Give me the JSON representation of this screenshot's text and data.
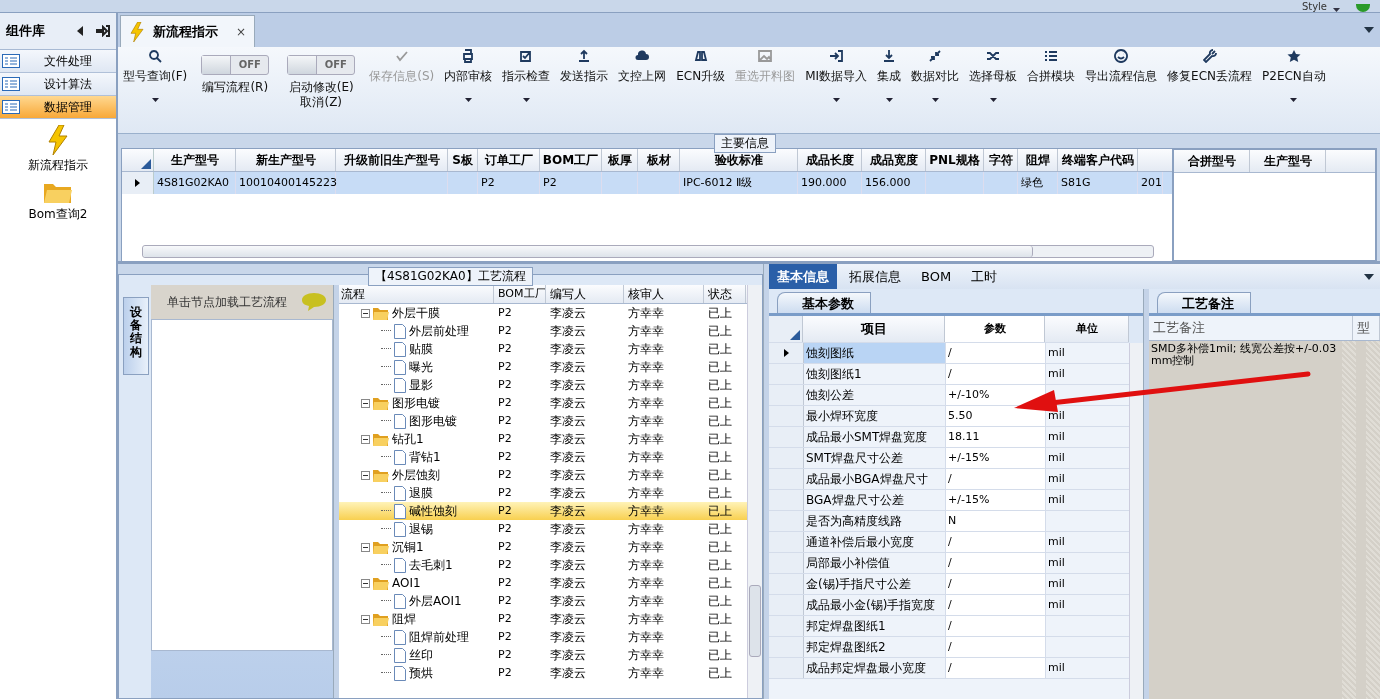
{
  "top_bar": {
    "style_menu": "Style"
  },
  "sidebar": {
    "title": "组件库",
    "items": [
      {
        "label": "文件处理",
        "selected": false
      },
      {
        "label": "设计算法",
        "selected": false
      },
      {
        "label": "数据管理",
        "selected": true
      }
    ],
    "shortcuts": [
      {
        "label": "新流程指示"
      },
      {
        "label": "Bom查询2"
      }
    ]
  },
  "tabs": [
    {
      "label": "新流程指示",
      "selected": true,
      "close": "×"
    }
  ],
  "toolbar": [
    {
      "kind": "button",
      "label": "型号查询(F)",
      "disabled": false,
      "dropdown": true
    },
    {
      "kind": "toggle",
      "label": "编写流程(R)",
      "toggle_text": "OFF",
      "on": false
    },
    {
      "kind": "toggle",
      "label": "启动修改(E) 取消(Z)",
      "toggle_text": "OFF",
      "on": false
    },
    {
      "kind": "button",
      "label": "保存信息(S)",
      "disabled": true,
      "dropdown": false
    },
    {
      "kind": "button",
      "label": "内部审核",
      "disabled": false,
      "dropdown": true
    },
    {
      "kind": "button",
      "label": "指示检查",
      "disabled": false,
      "dropdown": true
    },
    {
      "kind": "button",
      "label": "发送指示",
      "disabled": false,
      "dropdown": false
    },
    {
      "kind": "button",
      "label": "文控上网",
      "disabled": false,
      "dropdown": false
    },
    {
      "kind": "button",
      "label": "ECN升级",
      "disabled": false,
      "dropdown": false
    },
    {
      "kind": "button",
      "label": "重选开料图",
      "disabled": true,
      "dropdown": false
    },
    {
      "kind": "button",
      "label": "MI数据导入",
      "disabled": false,
      "dropdown": true
    },
    {
      "kind": "button",
      "label": "集成",
      "disabled": false,
      "dropdown": true
    },
    {
      "kind": "button",
      "label": "数据对比",
      "disabled": false,
      "dropdown": true
    },
    {
      "kind": "button",
      "label": "选择母板",
      "disabled": false,
      "dropdown": true
    },
    {
      "kind": "button",
      "label": "合拼模块",
      "disabled": false,
      "dropdown": false
    },
    {
      "kind": "button",
      "label": "导出流程信息",
      "disabled": false,
      "dropdown": false
    },
    {
      "kind": "button",
      "label": "修复ECN丢流程",
      "disabled": false,
      "dropdown": false
    },
    {
      "kind": "button",
      "label": "P2ECN自动",
      "disabled": false,
      "dropdown": true
    }
  ],
  "main_info": {
    "title": "主要信息",
    "columns": [
      "生产型号",
      "新生产型号",
      "升级前旧生产型号",
      "S板",
      "订单工厂",
      "BOM工厂",
      "板厚",
      "板材",
      "验收标准",
      "成品长度",
      "成品宽度",
      "PNL规格",
      "字符",
      "阻焊",
      "终端客户代码"
    ],
    "rows": [
      {
        "selected": true,
        "cells": [
          "4S81G02KA0",
          "10010400145223",
          null,
          null,
          "P2",
          "P2",
          null,
          null,
          "IPC-6012 Ⅱ级",
          "190.000",
          "156.000",
          null,
          null,
          "绿色",
          "S81G"
        ],
        "cut_cell": "201"
      }
    ],
    "side_columns": [
      "合拼型号",
      "生产型号"
    ]
  },
  "flow": {
    "title": "【4S81G02KA0】工艺流程",
    "side_tab": "设备结构",
    "hint": "单击节点加载工艺流程",
    "columns": [
      "流程",
      "BOM工厂",
      "编写人",
      "核审人",
      "状态"
    ],
    "rows": [
      {
        "name": "外层干膜",
        "bom": "P2",
        "writer": "李凌云",
        "reviewer": "方幸幸",
        "status": "已上",
        "expanded": true,
        "selected": false,
        "children": [
          {
            "name": "外层前处理",
            "bom": "P2",
            "writer": "李凌云",
            "reviewer": "方幸幸",
            "status": "已上",
            "selected": false
          },
          {
            "name": "贴膜",
            "bom": "P2",
            "writer": "李凌云",
            "reviewer": "方幸幸",
            "status": "已上",
            "selected": false
          },
          {
            "name": "曝光",
            "bom": "P2",
            "writer": "李凌云",
            "reviewer": "方幸幸",
            "status": "已上",
            "selected": false
          },
          {
            "name": "显影",
            "bom": "P2",
            "writer": "李凌云",
            "reviewer": "方幸幸",
            "status": "已上",
            "selected": false
          }
        ]
      },
      {
        "name": "图形电镀",
        "bom": "P2",
        "writer": "李凌云",
        "reviewer": "方幸幸",
        "status": "已上",
        "expanded": true,
        "selected": false,
        "children": [
          {
            "name": "图形电镀",
            "bom": "P2",
            "writer": "李凌云",
            "reviewer": "方幸幸",
            "status": "已上",
            "selected": false
          }
        ]
      },
      {
        "name": "钻孔1",
        "bom": "P2",
        "writer": "李凌云",
        "reviewer": "方幸幸",
        "status": "已上",
        "expanded": true,
        "selected": false,
        "children": [
          {
            "name": "背钻1",
            "bom": "P2",
            "writer": "李凌云",
            "reviewer": "方幸幸",
            "status": "已上",
            "selected": false
          }
        ]
      },
      {
        "name": "外层蚀刻",
        "bom": "P2",
        "writer": "李凌云",
        "reviewer": "方幸幸",
        "status": "已上",
        "expanded": true,
        "selected": false,
        "children": [
          {
            "name": "退膜",
            "bom": "P2",
            "writer": "李凌云",
            "reviewer": "方幸幸",
            "status": "已上",
            "selected": false
          },
          {
            "name": "碱性蚀刻",
            "bom": "P2",
            "writer": "李凌云",
            "reviewer": "方幸幸",
            "status": "已上",
            "selected": true
          },
          {
            "name": "退锡",
            "bom": "P2",
            "writer": "李凌云",
            "reviewer": "方幸幸",
            "status": "已上",
            "selected": false
          }
        ]
      },
      {
        "name": "沉铜1",
        "bom": "P2",
        "writer": "李凌云",
        "reviewer": "方幸幸",
        "status": "已上",
        "expanded": true,
        "selected": false,
        "children": [
          {
            "name": "去毛刺1",
            "bom": "P2",
            "writer": "李凌云",
            "reviewer": "方幸幸",
            "status": "已上",
            "selected": false
          }
        ]
      },
      {
        "name": "AOI1",
        "bom": "P2",
        "writer": "李凌云",
        "reviewer": "方幸幸",
        "status": "已上",
        "expanded": true,
        "selected": false,
        "children": [
          {
            "name": "外层AOI1",
            "bom": "P2",
            "writer": "李凌云",
            "reviewer": "方幸幸",
            "status": "已上",
            "selected": false
          }
        ]
      },
      {
        "name": "阻焊",
        "bom": "P2",
        "writer": "李凌云",
        "reviewer": "方幸幸",
        "status": "已上",
        "expanded": true,
        "selected": false,
        "children": [
          {
            "name": "阻焊前处理",
            "bom": "P2",
            "writer": "李凌云",
            "reviewer": "方幸幸",
            "status": "已上",
            "selected": false
          },
          {
            "name": "丝印",
            "bom": "P2",
            "writer": "李凌云",
            "reviewer": "方幸幸",
            "status": "已上",
            "selected": false
          },
          {
            "name": "预烘",
            "bom": "P2",
            "writer": "李凌云",
            "reviewer": "方幸幸",
            "status": "已上",
            "selected": false
          }
        ]
      }
    ]
  },
  "detail_tabs": [
    {
      "label": "基本信息",
      "selected": true
    },
    {
      "label": "拓展信息",
      "selected": false
    },
    {
      "label": "BOM",
      "selected": false
    },
    {
      "label": "工时",
      "selected": false
    }
  ],
  "params": {
    "title": "基本参数",
    "columns": [
      "项目",
      "参数",
      "单位"
    ],
    "rows": [
      {
        "item": "蚀刻图纸",
        "value": "/",
        "unit": "mil",
        "selected": true
      },
      {
        "item": "蚀刻图纸1",
        "value": "/",
        "unit": "mil",
        "selected": false
      },
      {
        "item": "蚀刻公差",
        "value": "+/-10%",
        "selected": false
      },
      {
        "item": "最小焊环宽度",
        "value": "5.50",
        "unit": "mil",
        "selected": false
      },
      {
        "item": "成品最小SMT焊盘宽度",
        "value": "18.11",
        "unit": "mil",
        "selected": false
      },
      {
        "item": "SMT焊盘尺寸公差",
        "value": "+/-15%",
        "unit": "mil",
        "selected": false
      },
      {
        "item": "成品最小BGA焊盘尺寸",
        "value": "/",
        "unit": "mil",
        "selected": false
      },
      {
        "item": "BGA焊盘尺寸公差",
        "value": "+/-15%",
        "unit": "mil",
        "selected": false
      },
      {
        "item": "是否为高精度线路",
        "value": "N",
        "selected": false
      },
      {
        "item": "通道补偿后最小宽度",
        "value": "/",
        "unit": "mil",
        "selected": false
      },
      {
        "item": "局部最小补偿值",
        "value": "/",
        "unit": "mil",
        "selected": false
      },
      {
        "item": "金(锡)手指尺寸公差",
        "value": "/",
        "unit": "mil",
        "selected": false
      },
      {
        "item": "成品最小金(锡)手指宽度",
        "value": "/",
        "unit": "mil",
        "selected": false
      },
      {
        "item": "邦定焊盘图纸1",
        "value": "/",
        "selected": false
      },
      {
        "item": "邦定焊盘图纸2",
        "value": "/",
        "selected": false
      },
      {
        "item": "成品邦定焊盘最小宽度",
        "value": "/",
        "unit": "mil",
        "selected": false
      }
    ]
  },
  "notes": {
    "title": "工艺备注",
    "columns": [
      "工艺备注",
      "型"
    ],
    "text": "SMD多补偿1mil; 线宽公差按+/-0.03mm控制"
  }
}
